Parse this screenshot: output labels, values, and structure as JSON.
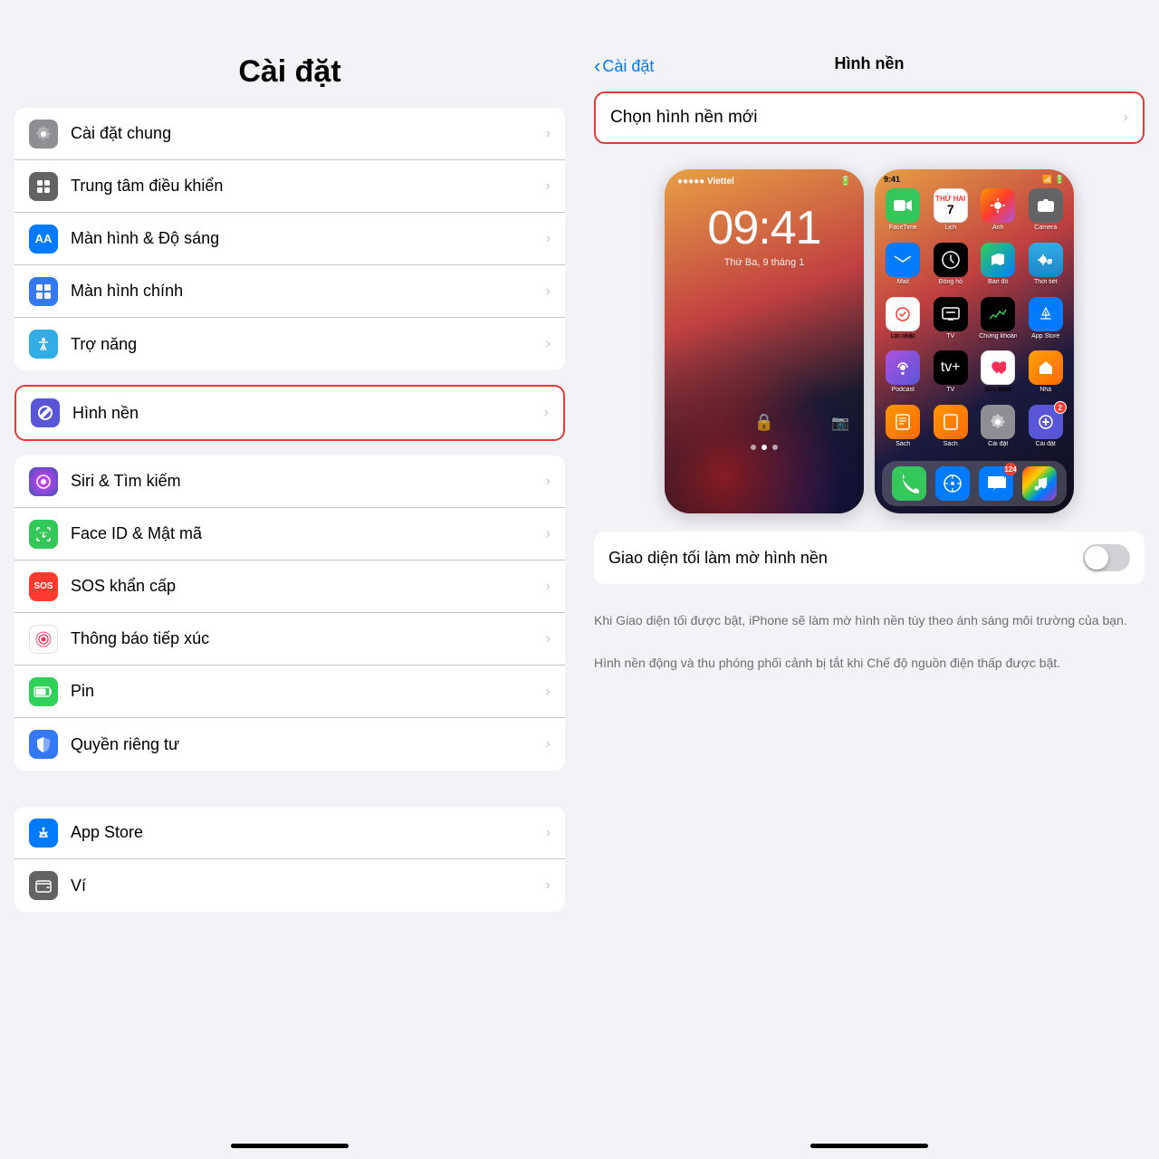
{
  "left": {
    "title": "Cài đặt",
    "groups": [
      {
        "items": [
          {
            "id": "cai-dat-chung",
            "icon": "⚙️",
            "iconBg": "icon-gray",
            "label": "Cài đặt chung",
            "highlighted": false
          },
          {
            "id": "trung-tam-dieu-khien",
            "icon": "⊟",
            "iconBg": "icon-gray2",
            "label": "Trung tâm điều khiển",
            "highlighted": false
          },
          {
            "id": "man-hinh-do-sang",
            "icon": "AA",
            "iconBg": "icon-blue",
            "label": "Màn hình & Độ sáng",
            "highlighted": false
          },
          {
            "id": "man-hinh-chinh",
            "icon": "⊞",
            "iconBg": "icon-blue2",
            "label": "Màn hình chính",
            "highlighted": false
          },
          {
            "id": "tro-nang",
            "icon": "♿",
            "iconBg": "icon-blue3",
            "label": "Trợ năng",
            "highlighted": false
          }
        ]
      },
      {
        "highlighted": true,
        "items": [
          {
            "id": "hinh-nen",
            "icon": "✿",
            "iconBg": "icon-purple",
            "label": "Hình nền",
            "highlighted": true
          }
        ]
      },
      {
        "items": [
          {
            "id": "siri-tim-kiem",
            "icon": "◉",
            "iconBg": "icon-gray",
            "label": "Siri & Tìm kiếm",
            "highlighted": false
          },
          {
            "id": "face-id-mat-ma",
            "icon": "☺",
            "iconBg": "icon-green",
            "label": "Face ID & Mật mã",
            "highlighted": false
          },
          {
            "id": "sos-khan-cap",
            "icon": "SOS",
            "iconBg": "icon-red",
            "label": "SOS khẩn cấp",
            "highlighted": false
          },
          {
            "id": "thong-bao-tiep-xuc",
            "icon": "⊛",
            "iconBg": "icon-pink",
            "label": "Thông báo tiếp xúc",
            "highlighted": false
          },
          {
            "id": "pin",
            "icon": "▬",
            "iconBg": "icon-green2",
            "label": "Pin",
            "highlighted": false
          },
          {
            "id": "quyen-rieng-tu",
            "icon": "✋",
            "iconBg": "icon-blue2",
            "label": "Quyền riêng tư",
            "highlighted": false
          }
        ]
      },
      {
        "items": [
          {
            "id": "app-store",
            "icon": "A",
            "iconBg": "icon-blue",
            "label": "App Store",
            "highlighted": false
          },
          {
            "id": "vi",
            "icon": "💳",
            "iconBg": "icon-gray2",
            "label": "Ví",
            "highlighted": false
          }
        ]
      }
    ]
  },
  "right": {
    "back_label": "Cài đặt",
    "title": "Hình nền",
    "choose_label": "Chọn hình nền mới",
    "lock_time": "09:41",
    "lock_date": "Thứ Ba, 9 tháng 1",
    "toggle_label": "Giao diện tối làm mờ hình nền",
    "toggle_on": false,
    "desc1": "Khi Giao diện tối được bật, iPhone sẽ làm mờ hình nền tùy theo ánh sáng môi trường của bạn.",
    "desc2": "Hình nền động và thu phóng phối cảnh bị tắt khi Chế độ nguồn điện thấp được bật."
  }
}
